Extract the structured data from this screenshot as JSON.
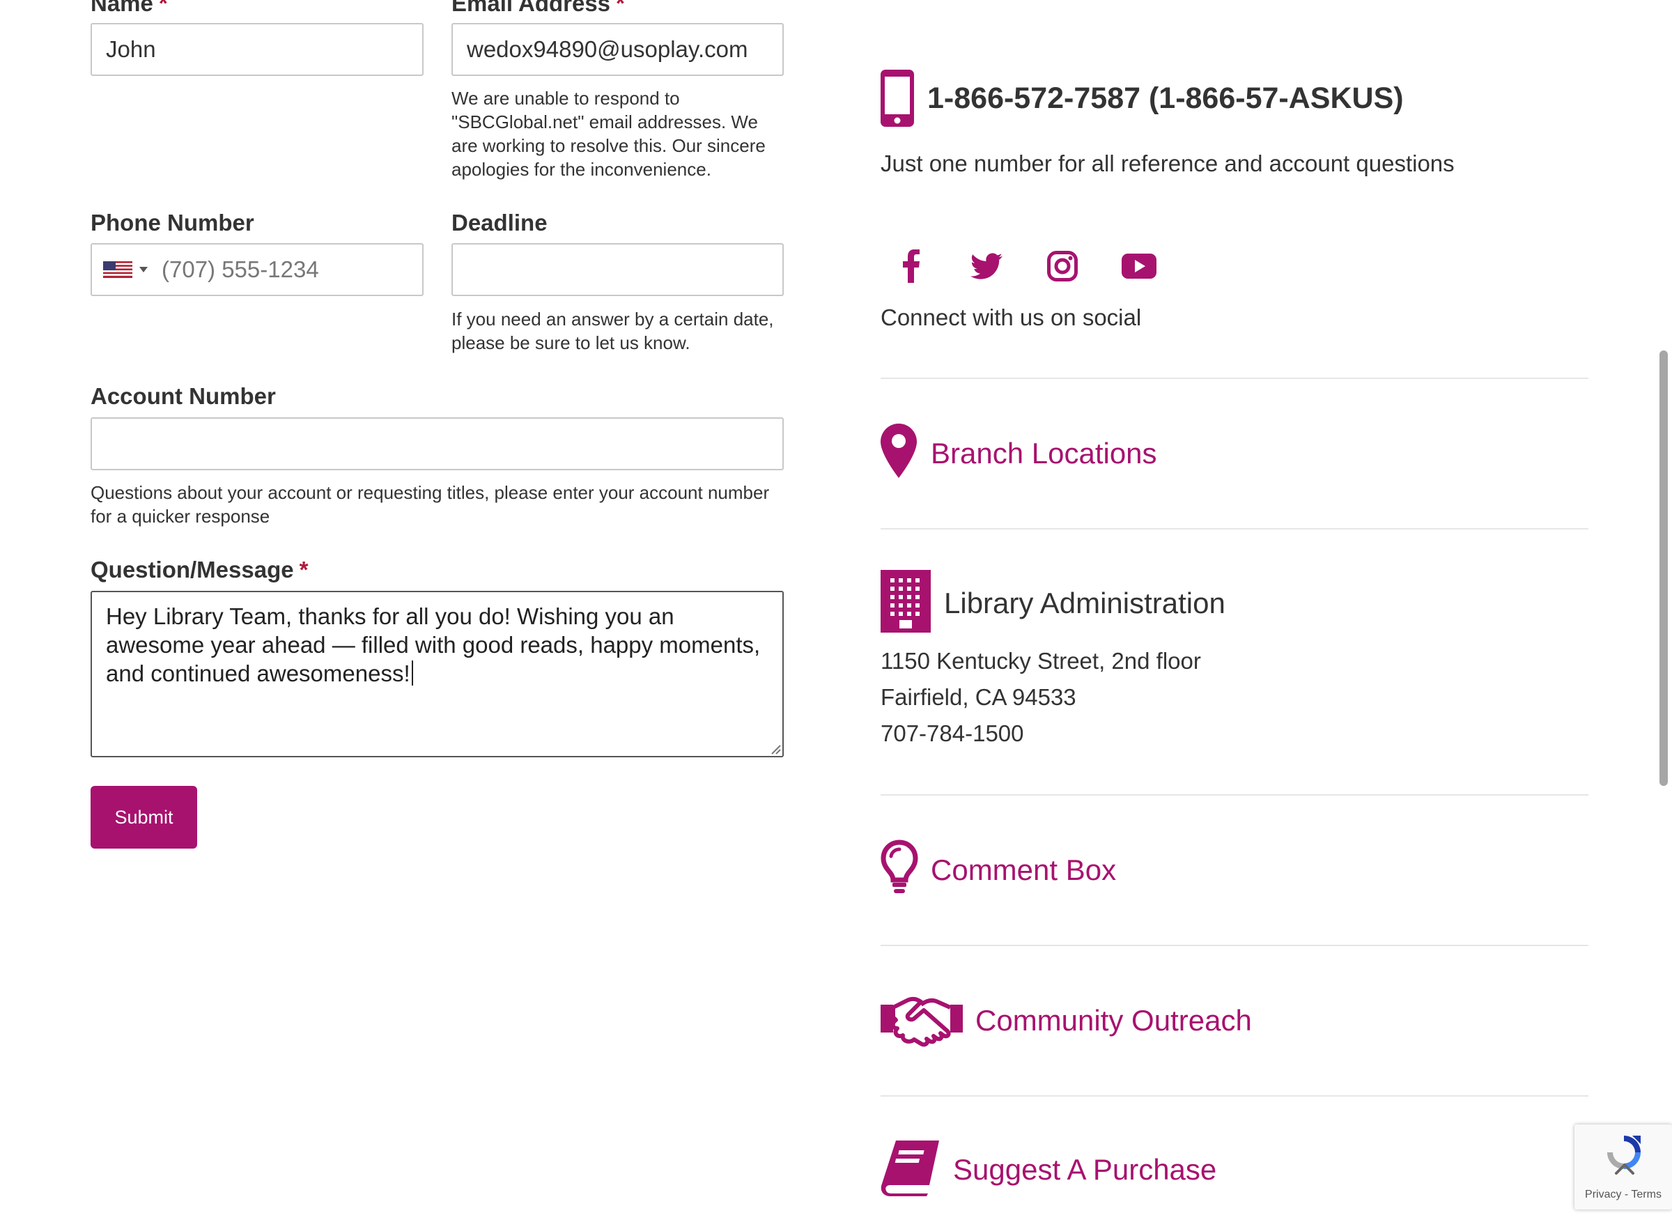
{
  "colors": {
    "accent": "#a7126f",
    "required": "#b0183a"
  },
  "form": {
    "name_label": "Name",
    "name_required": "*",
    "name_value": "John",
    "email_label": "Email Address",
    "email_required": "*",
    "email_value": "wedox94890@usoplay.com",
    "email_help": "We are unable to respond to \"SBCGlobal.net\" email addresses. We are working to resolve this. Our sincere apologies for the inconvenience.",
    "phone_label": "Phone Number",
    "phone_country_icon": "us-flag-icon",
    "phone_placeholder": "(707) 555-1234",
    "deadline_label": "Deadline",
    "deadline_value": "",
    "deadline_help": "If you need an answer by a certain date, please be sure to let us know.",
    "account_label": "Account Number",
    "account_value": "",
    "account_help": "Questions about your account or requesting titles, please enter your account number for a quicker response",
    "message_label": "Question/Message",
    "message_required": "*",
    "message_value": "Hey Library Team, thanks for all you do! Wishing you an awesome year ahead — filled with good reads, happy moments, and continued awesomeness!",
    "submit_label": "Submit"
  },
  "sidebar": {
    "phone_icon": "mobile-phone-icon",
    "phone_number": "1-866-572-7587 (1-866-57-ASKUS)",
    "phone_desc": "Just one number for all reference and account questions",
    "social_icons": [
      "facebook-icon",
      "twitter-icon",
      "instagram-icon",
      "youtube-icon"
    ],
    "social_text": "Connect with us on social",
    "branch_icon": "map-pin-icon",
    "branch_label": "Branch Locations",
    "admin_icon": "building-icon",
    "admin_title": "Library Administration",
    "admin_address1": "1150 Kentucky Street, 2nd floor",
    "admin_address2": "Fairfield, CA 94533",
    "admin_phone": "707-784-1500",
    "comment_icon": "lightbulb-icon",
    "comment_label": "Comment Box",
    "outreach_icon": "handshake-icon",
    "outreach_label": "Community Outreach",
    "purchase_icon": "book-icon",
    "purchase_label": "Suggest A Purchase"
  },
  "recaptcha": {
    "privacy": "Privacy",
    "separator": "-",
    "terms": "Terms"
  }
}
